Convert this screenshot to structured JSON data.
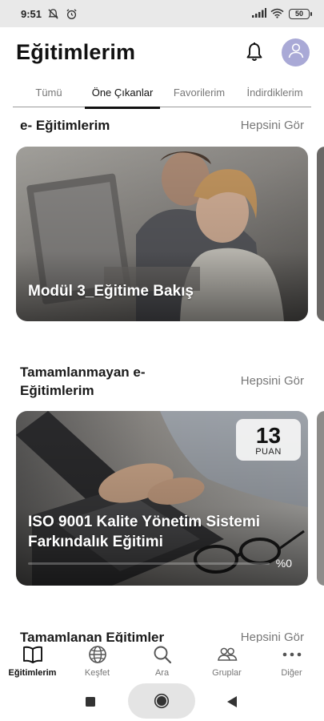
{
  "status_bar": {
    "time": "9:51",
    "battery": "50"
  },
  "header": {
    "title": "Eğitimlerim",
    "icons": [
      "bell-icon",
      "user-avatar-icon"
    ]
  },
  "tabs": [
    {
      "label": "Tümü",
      "active": false
    },
    {
      "label": "Öne Çıkanlar",
      "active": true
    },
    {
      "label": "Favorilerim",
      "active": false
    },
    {
      "label": "İndirdiklerim",
      "active": false
    }
  ],
  "sections": {
    "elearning": {
      "title": "e- Eğitimlerim",
      "see_all": "Hepsini Gör",
      "card": {
        "title": "Modül 3_Eğitime Bakış"
      }
    },
    "incomplete": {
      "title": "Tamamlanmayan e-Eğitimlerim",
      "see_all": "Hepsini Gör",
      "card": {
        "title": "ISO 9001 Kalite Yönetim Sistemi Farkındalık Eğitimi",
        "points_value": "13",
        "points_label": "PUAN",
        "progress_text": "%0",
        "progress": 0
      }
    },
    "completed": {
      "title": "Tamamlanan Eğitimler",
      "see_all": "Hepsini Gör"
    }
  },
  "bottom_nav": [
    {
      "label": "Eğitimlerim",
      "icon": "book-icon",
      "active": true
    },
    {
      "label": "Keşfet",
      "icon": "globe-icon",
      "active": false
    },
    {
      "label": "Ara",
      "icon": "search-icon",
      "active": false
    },
    {
      "label": "Gruplar",
      "icon": "group-icon",
      "active": false
    },
    {
      "label": "Diğer",
      "icon": "more-icon",
      "active": false
    }
  ],
  "colors": {
    "accent": "#111111",
    "muted": "#777777",
    "avatar_bg": "#a9a9d6",
    "status_bar_bg": "#e9e9e9"
  }
}
